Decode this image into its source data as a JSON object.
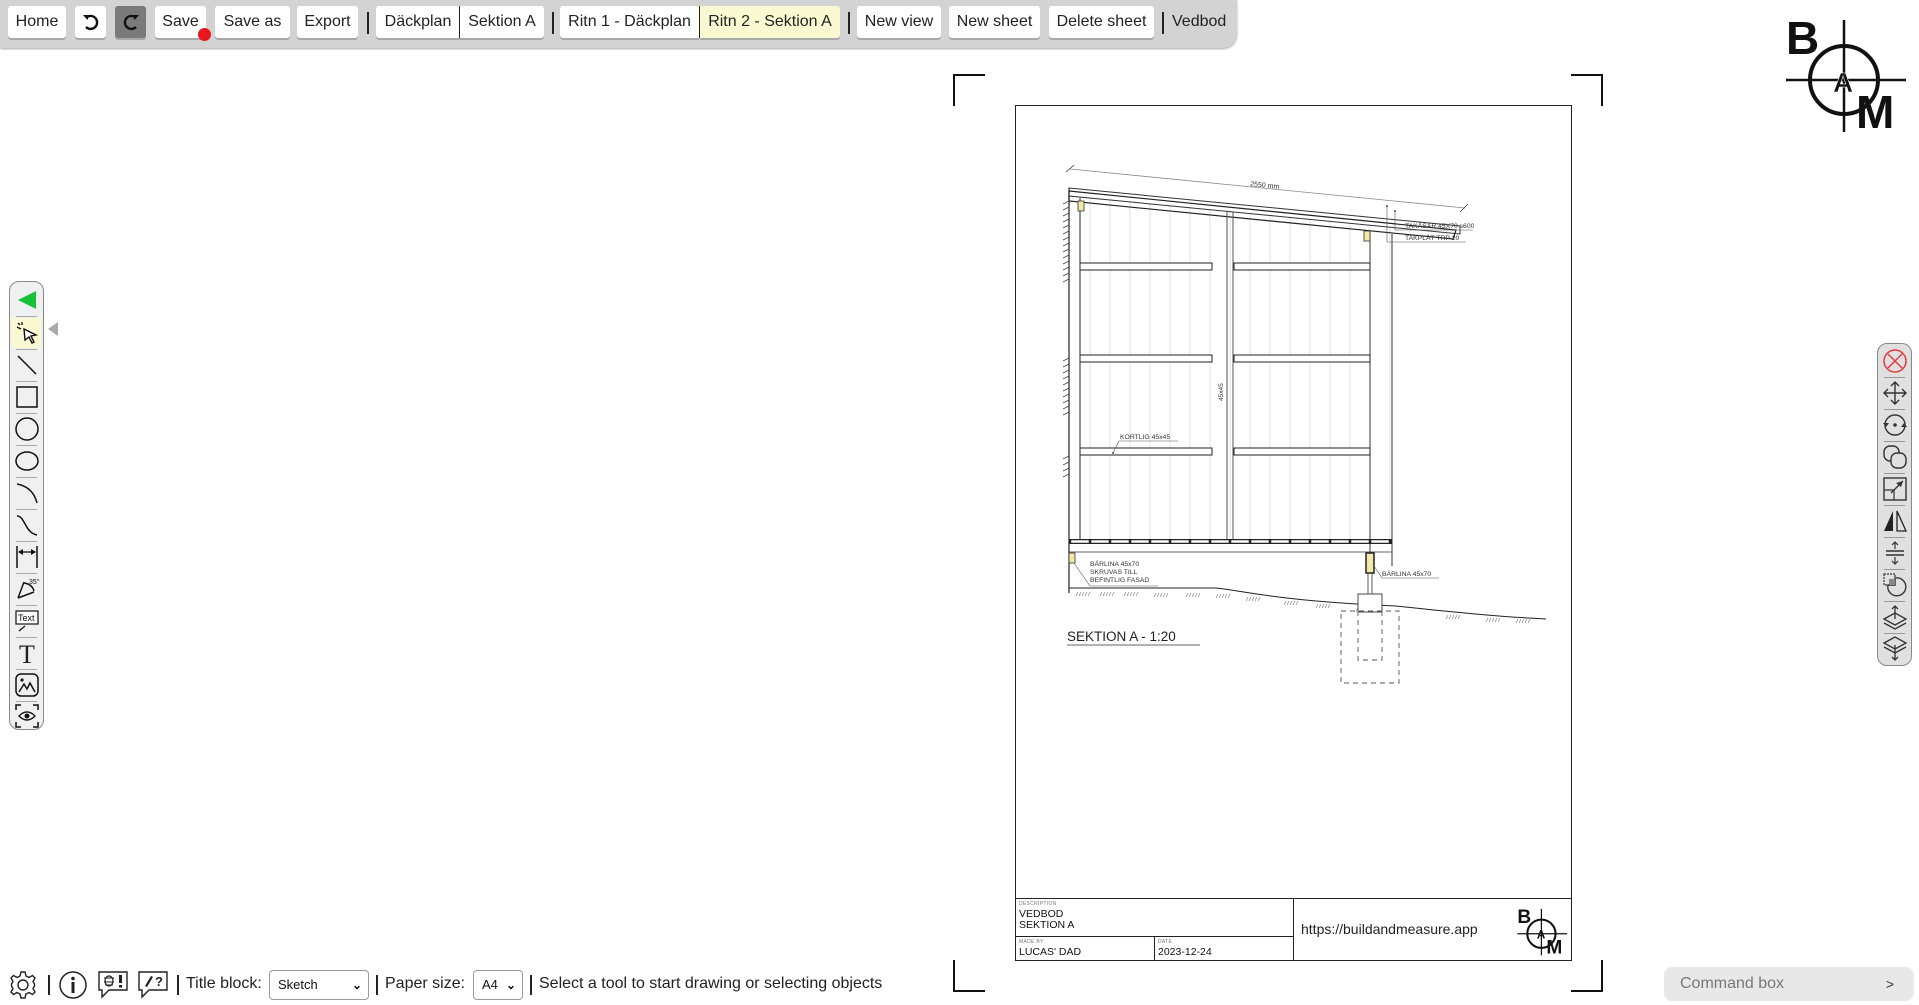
{
  "toolbar": {
    "home_label": "Home",
    "undo_icon": "undo-icon",
    "redo_icon": "redo-icon",
    "save_label": "Save",
    "save_unsaved_indicator_color": "#e8161e",
    "save_as_label": "Save as",
    "export_label": "Export",
    "views": [
      {
        "label": "Däckplan",
        "active": false
      },
      {
        "label": "Sektion A",
        "active": false
      }
    ],
    "sheets": [
      {
        "label": "Ritn 1 - Däckplan",
        "active": false
      },
      {
        "label": "Ritn 2 - Sektion A",
        "active": true
      }
    ],
    "new_view_label": "New view",
    "new_sheet_label": "New sheet",
    "delete_sheet_label": "Delete sheet",
    "project_name": "Vedbod"
  },
  "logo": {
    "letters": [
      "B",
      "A",
      "M"
    ]
  },
  "left_tools": [
    {
      "name": "collapse-toolbox",
      "icon": "green-triangle-icon"
    },
    {
      "name": "select",
      "icon": "select-cursor-icon",
      "selected": true
    },
    {
      "name": "line",
      "icon": "line-icon"
    },
    {
      "name": "rectangle",
      "icon": "rectangle-icon"
    },
    {
      "name": "circle",
      "icon": "circle-icon"
    },
    {
      "name": "ellipse",
      "icon": "ellipse-icon"
    },
    {
      "name": "arc",
      "icon": "arc-icon"
    },
    {
      "name": "spline",
      "icon": "spline-icon"
    },
    {
      "name": "dimension",
      "icon": "dimension-icon"
    },
    {
      "name": "angle-dimension",
      "icon": "angle-dimension-icon"
    },
    {
      "name": "text-label",
      "icon": "text-label-icon",
      "glyph": "Text"
    },
    {
      "name": "text",
      "icon": "text-icon",
      "glyph": "T"
    },
    {
      "name": "image",
      "icon": "image-icon"
    },
    {
      "name": "view",
      "icon": "view-eye-icon"
    }
  ],
  "right_tools": [
    {
      "name": "delete",
      "icon": "delete-x-icon"
    },
    {
      "name": "move",
      "icon": "move-icon"
    },
    {
      "name": "rotate",
      "icon": "rotate-icon"
    },
    {
      "name": "copy",
      "icon": "copy-icon"
    },
    {
      "name": "scale",
      "icon": "scale-icon"
    },
    {
      "name": "mirror",
      "icon": "mirror-icon"
    },
    {
      "name": "offset",
      "icon": "offset-icon"
    },
    {
      "name": "trim",
      "icon": "trim-icon"
    },
    {
      "name": "bring-forward",
      "icon": "layer-up-icon"
    },
    {
      "name": "send-backward",
      "icon": "layer-down-icon"
    }
  ],
  "drawing": {
    "dimension_label": "2550 mm",
    "annotations": {
      "takasar": "TAKÅSAR 45X70 s600",
      "takplat": "TAKPLÅT TRP 20",
      "kortlig": "KORTLIG 45x45",
      "stud": "45x45",
      "barlina_left_1": "BÄRLINA 45x70",
      "barlina_left_2": "SKRUVAS TILL",
      "barlina_left_3": "BEFINTLIG FASAD",
      "barlina_right": "BÄRLINA 45x70"
    },
    "section_title": "SEKTION A - 1:20"
  },
  "titleblock": {
    "description_label": "DESCRIPTION",
    "description_line1": "VEDBOD",
    "description_line2": "SEKTION A",
    "made_by_label": "MADE BY",
    "made_by": "LUCAS' DAD",
    "date_label": "DATE",
    "date": "2023-12-24",
    "url": "https://buildandmeasure.app"
  },
  "bottombar": {
    "settings_icon": "gear-icon",
    "info_icon": "info-icon",
    "bug_report_icon": "bug-report-icon",
    "feedback_icon": "feedback-icon",
    "title_block_label": "Title block:",
    "title_block_value": "Sketch",
    "paper_size_label": "Paper size:",
    "paper_size_value": "A4",
    "status": "Select a tool to start drawing or selecting objects"
  },
  "command_box": {
    "placeholder": "Command box",
    "submit": ">"
  }
}
